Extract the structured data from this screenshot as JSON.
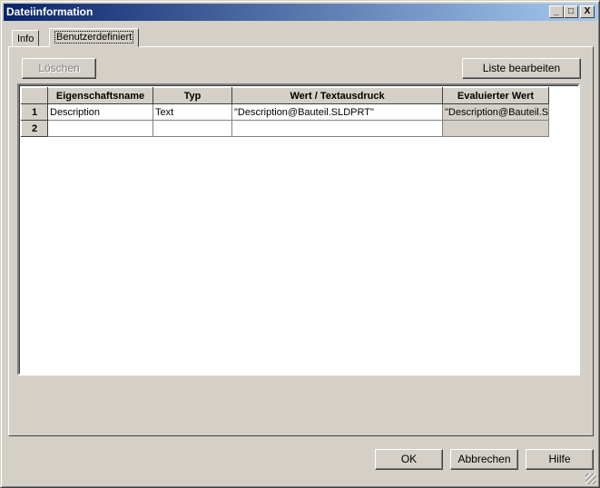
{
  "window": {
    "title": "Dateiinformation",
    "minimize": "_",
    "maximize": "□",
    "close": "X"
  },
  "tabs": [
    {
      "label": "Info"
    },
    {
      "label": "Benutzerdefiniert",
      "active": true
    }
  ],
  "toolbar": {
    "delete_label": "Löschen",
    "edit_list_label": "Liste bearbeiten"
  },
  "grid": {
    "columns": [
      "Eigenschaftsname",
      "Typ",
      "Wert / Textausdruck",
      "Evaluierter Wert"
    ],
    "rows": [
      {
        "num": "1",
        "name": "Description",
        "type": "Text",
        "value": "\"Description@Bauteil.SLDPRT\"",
        "evaluated": "\"Description@Bauteil.S"
      },
      {
        "num": "2",
        "name": "",
        "type": "",
        "value": "",
        "evaluated": ""
      }
    ]
  },
  "footer": {
    "ok": "OK",
    "cancel": "Abbrechen",
    "help": "Hilfe"
  }
}
